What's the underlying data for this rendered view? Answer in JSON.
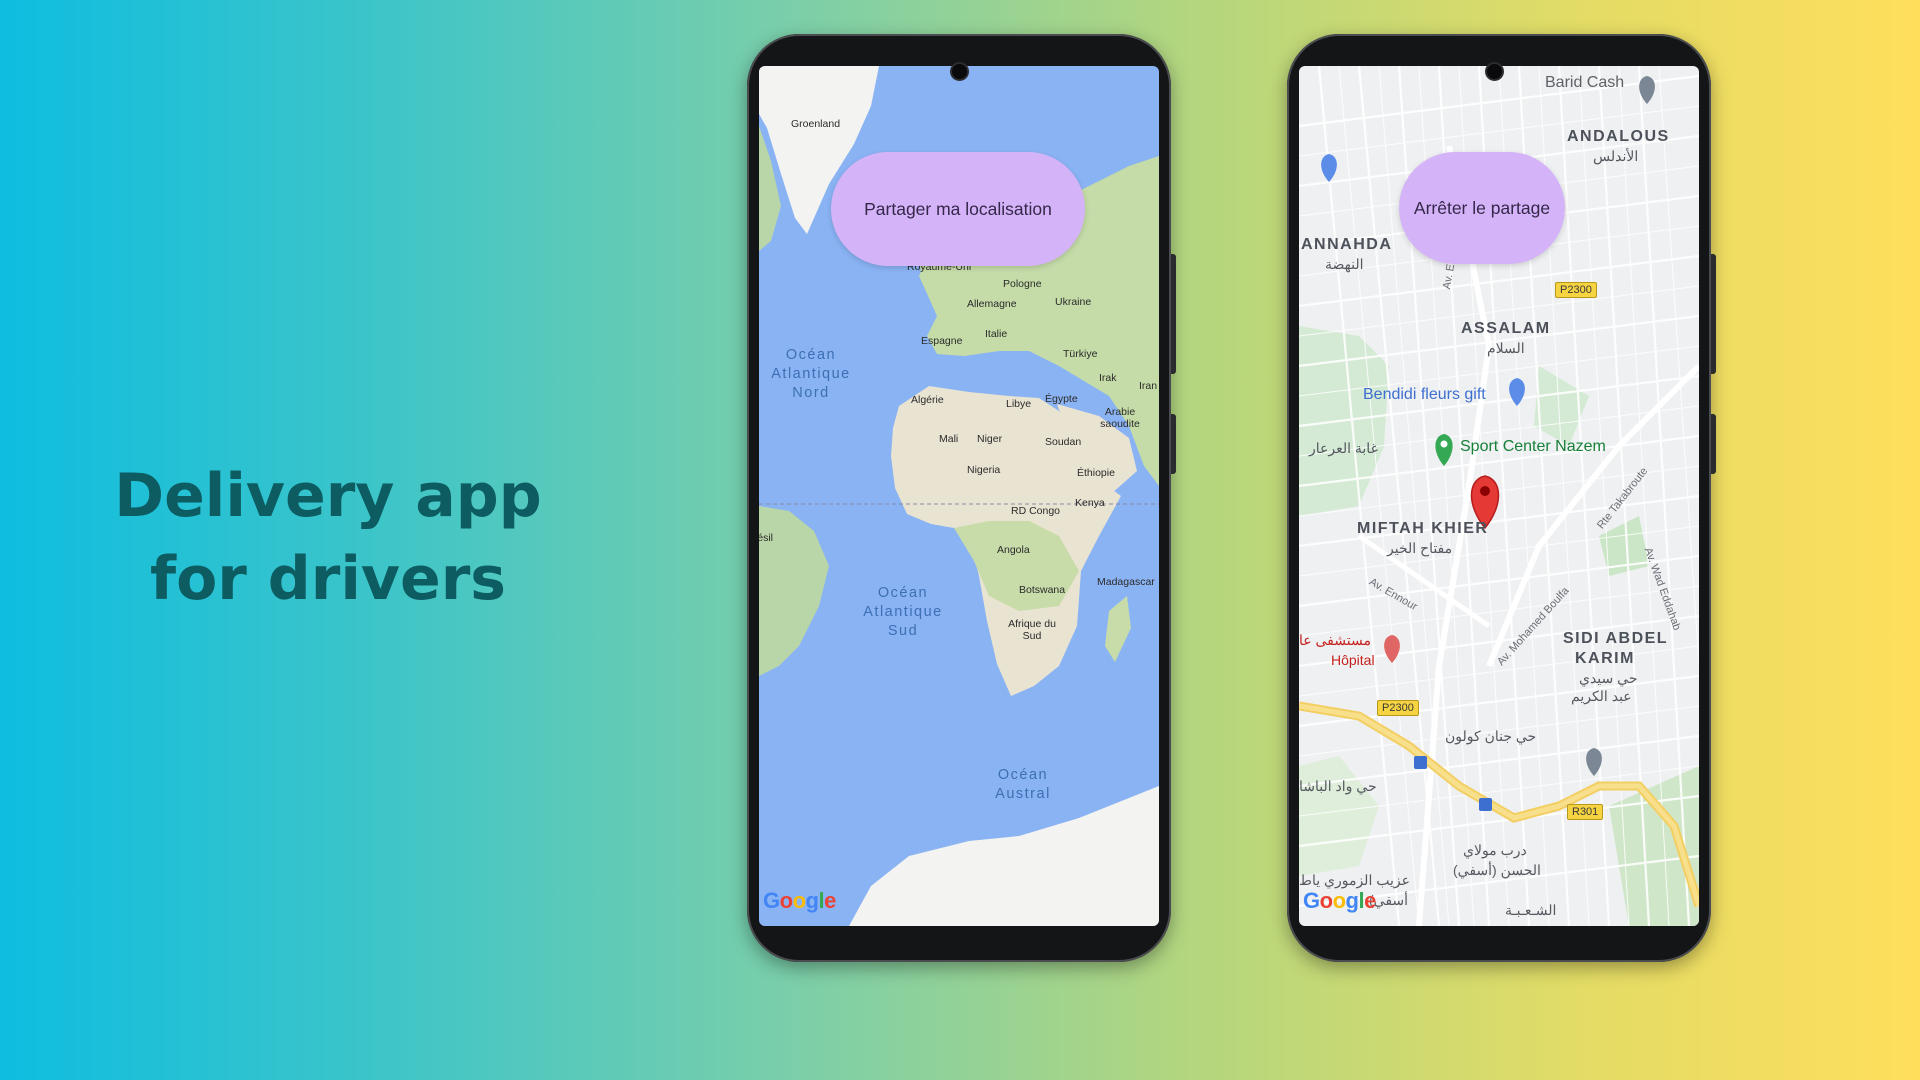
{
  "headline": {
    "line1": "Delivery app",
    "line2": "for drivers"
  },
  "phone1": {
    "button_label": "Partager ma localisation",
    "map_attribution": "Google",
    "countries": [
      "Groenland",
      "Royaume-Uni",
      "Pologne",
      "Allemagne",
      "Ukraine",
      "Italie",
      "Espagne",
      "Türkiye",
      "Algérie",
      "Libye",
      "Égypte",
      "Irak",
      "Iran",
      "Arabie saoudite",
      "Mali",
      "Niger",
      "Soudan",
      "Nigeria",
      "Éthiopie",
      "Kenya",
      "RD Congo",
      "Angola",
      "Botswana",
      "Afrique du Sud",
      "Madagascar",
      "Brésil"
    ],
    "oceans": {
      "north_atlantic": [
        "Océan",
        "Atlantique",
        "Nord"
      ],
      "south_atlantic": [
        "Océan",
        "Atlantique",
        "Sud"
      ],
      "southern": [
        "Océan",
        "Austral"
      ]
    }
  },
  "phone2": {
    "button_label": "Arrêter le partage",
    "map_attribution": "Google",
    "districts": {
      "andalous": "ANDALOUS",
      "andalous_ar": "الأندلس",
      "annahda": "ANNAHDA",
      "annahda_ar": "النهضة",
      "assalam": "ASSALAM",
      "assalam_ar": "السلام",
      "miftah": "MIFTAH KHIER",
      "miftah_ar": "مفتاح الخير",
      "sidi1": "SIDI ABDEL",
      "sidi2": "KARIM",
      "sidi_ar1": "حي سيدي",
      "sidi_ar2": "عبد الكريم"
    },
    "pois": {
      "barid": "Barid Cash",
      "bendidi": "Bendidi fleurs gift",
      "sport": "Sport Center Nazem",
      "hopital": "Hôpital",
      "hopital_ar": "مستشفى عا"
    },
    "arabic_places": {
      "ghaba": "غابة العرعار",
      "jnane": "حي جنان كولون",
      "oued": "حي واد الباشا",
      "derb1": "درب مولاي",
      "derb2": "الحسن (أسفي)",
      "azib": "عزيب الزموري ياط",
      "asfi": "(أسفي",
      "chaaba": "الشـعـبـة"
    },
    "roads": {
      "el_araa": "Av. El Araa",
      "takabroute": "Rte Takabroute",
      "ennour": "Av. Ennour",
      "boulfa": "Av. Mohamed Boulfa",
      "eddahab": "Av. Wad Eddahab"
    },
    "shields": [
      "P2300",
      "P2300",
      "R301"
    ]
  },
  "colors": {
    "pill": "#d5b3f8",
    "headline": "#0c5c61",
    "marker": "#e53935"
  }
}
